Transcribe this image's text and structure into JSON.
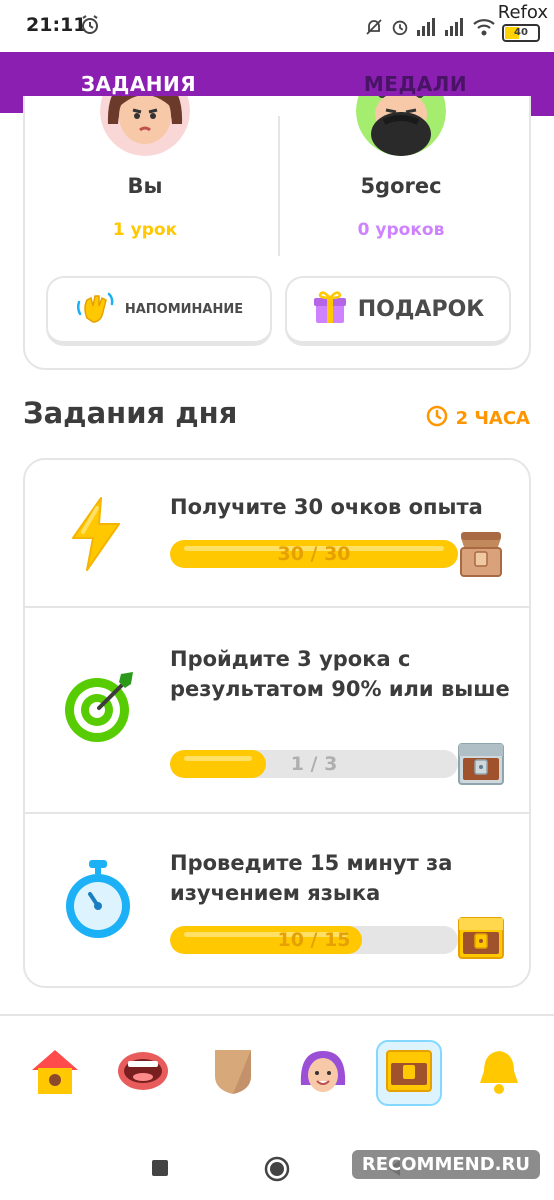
{
  "status_bar": {
    "time": "21:11",
    "battery": "40",
    "overlay_label": "Refox"
  },
  "tabs": [
    {
      "label": "ЗАДАНИЯ",
      "active": true
    },
    {
      "label": "МЕДАЛИ",
      "active": false
    }
  ],
  "friends": {
    "me": {
      "name": "Вы",
      "lessons": "1 урок",
      "lessons_color": "#ffc800"
    },
    "other": {
      "name": "5gorec",
      "lessons": "0 уроков",
      "lessons_color": "#ce82ff"
    },
    "reminder_label": "НАПОМИНАНИЕ",
    "gift_label": "ПОДАРОК"
  },
  "daily_quests": {
    "title": "Задания дня",
    "timer": "2 ЧАСА",
    "items": [
      {
        "title": "Получите 30 очков опыта",
        "progress_text": "30 / 30",
        "progress": 1.0,
        "icon": "lightning-icon"
      },
      {
        "title": "Пройдите 3 урока с результатом 90% или выше",
        "progress_text": "1 / 3",
        "progress": 0.3333,
        "icon": "target-icon"
      },
      {
        "title": "Проведите 15 минут за изучением языка",
        "progress_text": "10 / 15",
        "progress": 0.6667,
        "icon": "stopwatch-icon"
      }
    ]
  },
  "bottom_nav": [
    {
      "name": "home",
      "icon": "house-icon",
      "active": false
    },
    {
      "name": "speaking",
      "icon": "mouth-icon",
      "active": false
    },
    {
      "name": "league",
      "icon": "shield-icon",
      "active": false
    },
    {
      "name": "profile",
      "icon": "avatar-icon",
      "active": false
    },
    {
      "name": "quests",
      "icon": "chest-icon",
      "active": true
    },
    {
      "name": "notifications",
      "icon": "bell-icon",
      "active": false
    }
  ],
  "watermark": "RECOMMEND.RU",
  "colors": {
    "brand_purple": "#8b1fb2",
    "progress_yellow": "#ffc800",
    "timer_orange": "#ff9600",
    "border_gray": "#e5e5e5"
  }
}
